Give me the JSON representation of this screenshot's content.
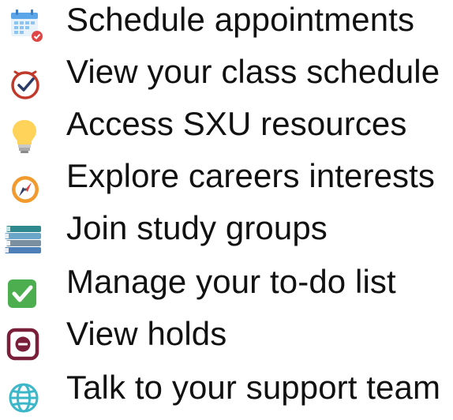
{
  "items": [
    {
      "icon": "calendar-icon",
      "label": "Schedule appointments"
    },
    {
      "icon": "clock-check-icon",
      "label": "View your class schedule"
    },
    {
      "icon": "lightbulb-icon",
      "label": "Access SXU resources"
    },
    {
      "icon": "compass-icon",
      "label": "Explore careers interests"
    },
    {
      "icon": "books-icon",
      "label": "Join study groups"
    },
    {
      "icon": "checkbox-icon",
      "label": "Manage your to-do list"
    },
    {
      "icon": "minus-circle-box-icon",
      "label": "View holds"
    },
    {
      "icon": "globe-icon",
      "label": "Talk to your support team"
    }
  ],
  "colors": {
    "calendar_blue": "#5aa6e8",
    "clock_red": "#c0392b",
    "bulb_yellow": "#ffd35a",
    "compass_orange": "#f39a2e",
    "checkbox_green": "#4cae4f",
    "holds_maroon": "#7a1f3a",
    "globe_teal": "#3cb6c9"
  }
}
